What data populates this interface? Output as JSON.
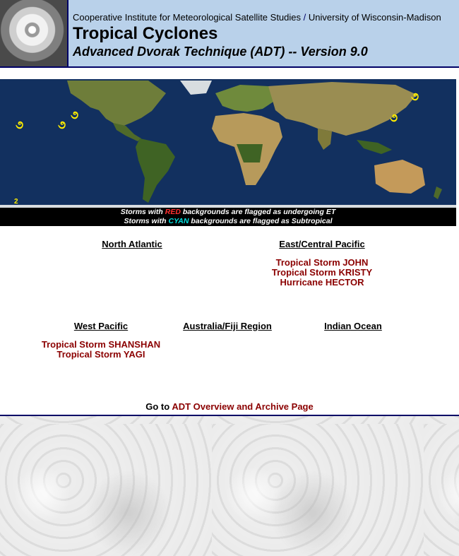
{
  "header": {
    "institute": "Cooperative Institute for Meteorological Satellite Studies",
    "separator": "/",
    "university": "University of Wisconsin-Madison",
    "title": "Tropical Cyclones",
    "subtitle": "Advanced Dvorak Technique (ADT) -- Version 9.0"
  },
  "map": {
    "marker_symbol": "૭",
    "corner_label": "2",
    "marker_color": "#ffee00"
  },
  "legend": {
    "line1_prefix": "Storms with ",
    "line1_keyword": "RED",
    "line1_suffix": " backgrounds are flagged as undergoing ET",
    "line2_prefix": "Storms with ",
    "line2_keyword": "CYAN",
    "line2_suffix": " backgrounds are flagged as Subtropical"
  },
  "regions": {
    "north_atlantic": {
      "heading": "North Atlantic",
      "storms": []
    },
    "east_central_pacific": {
      "heading": "East/Central Pacific",
      "storms": [
        "Tropical Storm JOHN",
        "Tropical Storm KRISTY",
        "Hurricane HECTOR"
      ]
    },
    "west_pacific": {
      "heading": "West Pacific",
      "storms": [
        "Tropical Storm SHANSHAN",
        "Tropical Storm YAGI"
      ]
    },
    "australia_fiji": {
      "heading": "Australia/Fiji Region",
      "storms": []
    },
    "indian_ocean": {
      "heading": "Indian Ocean",
      "storms": []
    }
  },
  "footer": {
    "prefix": "Go to ",
    "link_text": "ADT Overview and Archive Page"
  },
  "colors": {
    "header_bg": "#b9d1ea",
    "border": "#000066",
    "storm_link": "#8b0000"
  }
}
